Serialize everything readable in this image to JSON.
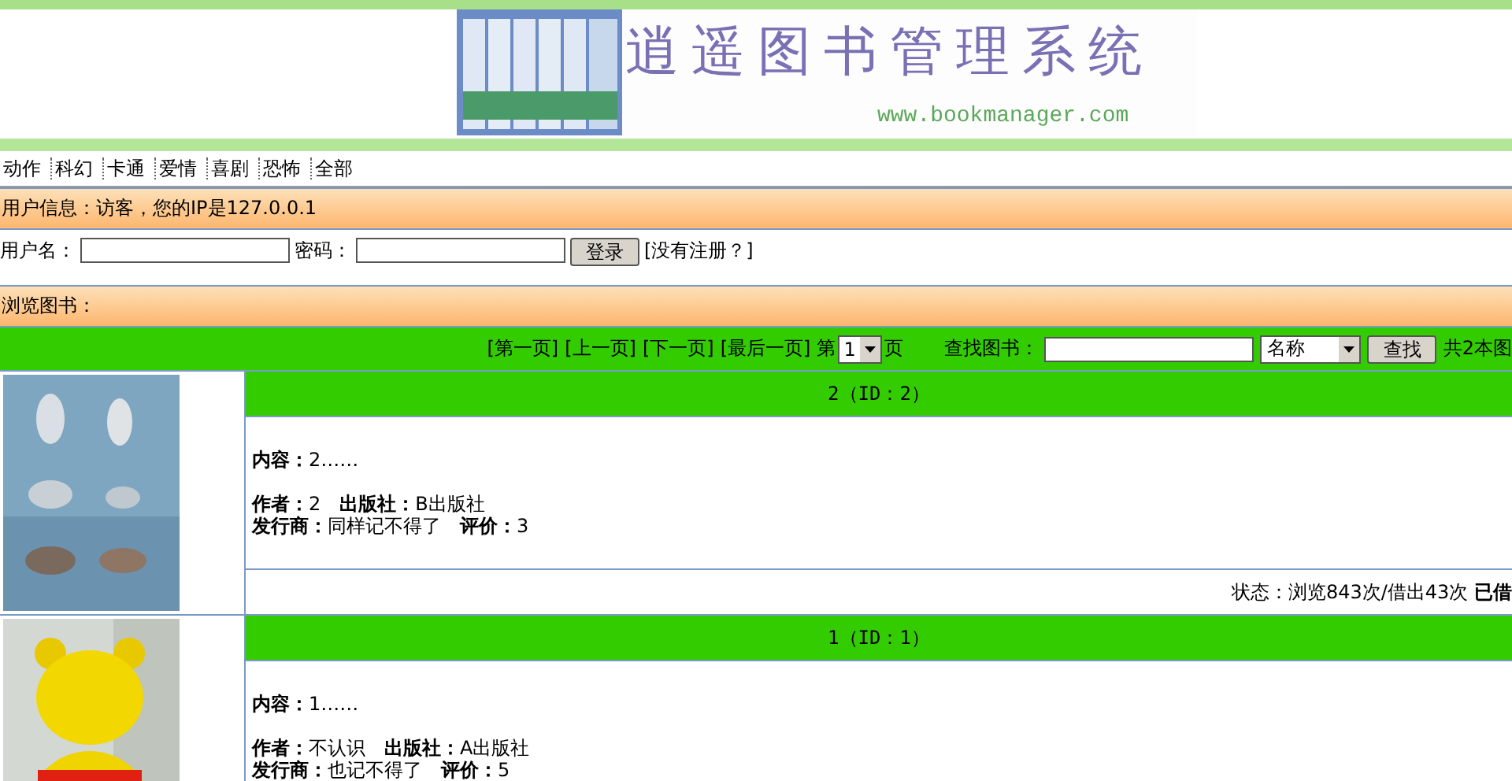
{
  "banner": {
    "title": "逍遥图书管理系统",
    "url": "www.bookmanager.com"
  },
  "nav": [
    "动作",
    "科幻",
    "卡通",
    "爱情",
    "喜剧",
    "恐怖",
    "全部"
  ],
  "user_info": "用户信息：访客，您的IP是127.0.0.1",
  "login": {
    "username_label": "用户名：",
    "password_label": "密码：",
    "button": "登录",
    "register_link": "[没有注册？]"
  },
  "browse_heading": "浏览图书：",
  "toolbar": {
    "pager_links": [
      "[第一页]",
      "[上一页]",
      "[下一页]",
      "[最后一页]"
    ],
    "page_prefix": "第",
    "page_value": "1",
    "page_suffix": "页",
    "search_label": "查找图书：",
    "search_field": "名称",
    "search_button": "查找",
    "total": "共2本图"
  },
  "books": [
    {
      "title": "2（ID：2）",
      "lines": [
        "**内容：**2……",
        "**作者：**2　**出版社：**B出版社",
        "**发行商：**同样记不得了　**评价：**3"
      ],
      "status": "状态：浏览843次/借出43次 **已借**"
    },
    {
      "title": "1（ID：1）",
      "lines": [
        "**内容：**1……",
        "**作者：**不认识　**出版社：**A出版社",
        "**发行商：**也记不得了　**评价：**5"
      ]
    }
  ]
}
